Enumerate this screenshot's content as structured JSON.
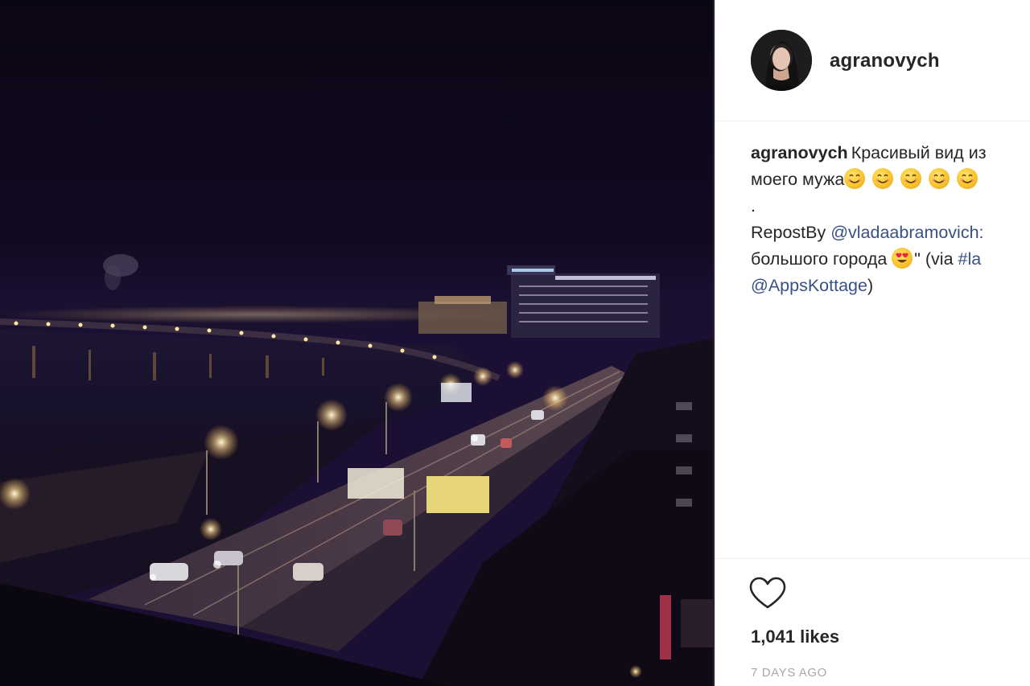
{
  "post": {
    "username": "agranovych",
    "avatar_icon": "user-avatar-icon",
    "caption": {
      "username": "agranovych",
      "line1_text": "Красивый вид из",
      "line2_text": "моего мужа",
      "line3_text": ".",
      "line4_prefix": "RepostBy ",
      "line4_mention": "@vladaabramovich:",
      "line5_text": "большого города ",
      "line5_suffix": "\" (via ",
      "line5_hashtag": "#la",
      "line6_mention": "@AppsKottage",
      "line6_suffix": ")",
      "smile_emoji_count": 5
    },
    "like_icon": "heart-outline-icon",
    "likes": "1,041 likes",
    "timestamp": "7 DAYS AGO"
  },
  "colors": {
    "link": "#385185",
    "text": "#262626",
    "muted": "#a8a8a8",
    "night_sky": "#0c0716"
  }
}
